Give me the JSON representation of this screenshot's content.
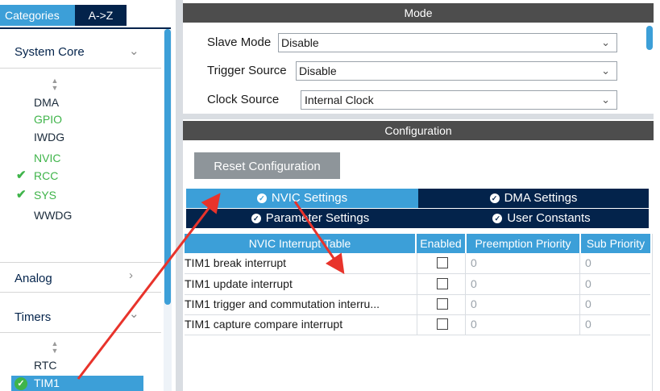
{
  "sidebar": {
    "tab_categories": "Categories",
    "tab_az": "A->Z",
    "system_core": {
      "title": "System Core",
      "items": [
        {
          "label": "DMA",
          "state": "plain"
        },
        {
          "label": "GPIO",
          "state": "green"
        },
        {
          "label": "IWDG",
          "state": "plain"
        },
        {
          "label": "NVIC",
          "state": "green"
        },
        {
          "label": "RCC",
          "state": "checked"
        },
        {
          "label": "SYS",
          "state": "checked"
        },
        {
          "label": "WWDG",
          "state": "plain"
        }
      ]
    },
    "analog": {
      "title": "Analog"
    },
    "timers": {
      "title": "Timers",
      "items": [
        {
          "label": "RTC",
          "state": "plain"
        },
        {
          "label": "TIM1",
          "state": "selected"
        }
      ]
    }
  },
  "mode": {
    "header": "Mode",
    "slave_mode": {
      "label": "Slave Mode",
      "value": "Disable"
    },
    "trigger_source": {
      "label": "Trigger Source",
      "value": "Disable"
    },
    "clock_source": {
      "label": "Clock Source",
      "value": "Internal Clock"
    }
  },
  "configuration": {
    "header": "Configuration",
    "reset_button": "Reset Configuration",
    "tabs": {
      "nvic": "NVIC Settings",
      "dma": "DMA Settings",
      "parameter": "Parameter Settings",
      "user": "User Constants"
    },
    "table": {
      "headers": [
        "NVIC Interrupt Table",
        "Enabled",
        "Preemption Priority",
        "Sub Priority"
      ],
      "rows": [
        {
          "name": "TIM1 break interrupt",
          "enabled": false,
          "preemption": "0",
          "sub": "0"
        },
        {
          "name": "TIM1 update interrupt",
          "enabled": false,
          "preemption": "0",
          "sub": "0"
        },
        {
          "name": "TIM1 trigger and commutation interru...",
          "enabled": false,
          "preemption": "0",
          "sub": "0"
        },
        {
          "name": "TIM1 capture compare interrupt",
          "enabled": false,
          "preemption": "0",
          "sub": "0"
        }
      ]
    }
  },
  "colors": {
    "accent": "#3c9fd8",
    "navy": "#03234b",
    "green": "#3fb44a",
    "annotation_arrow": "#e8332b"
  },
  "icons": {
    "sort": "sort-updown-icon",
    "check": "check-icon",
    "tab_ok": "check-circle-icon",
    "dropdown": "chevron-down-icon",
    "collapse": "chevron-down-icon",
    "expand": "chevron-right-icon"
  }
}
